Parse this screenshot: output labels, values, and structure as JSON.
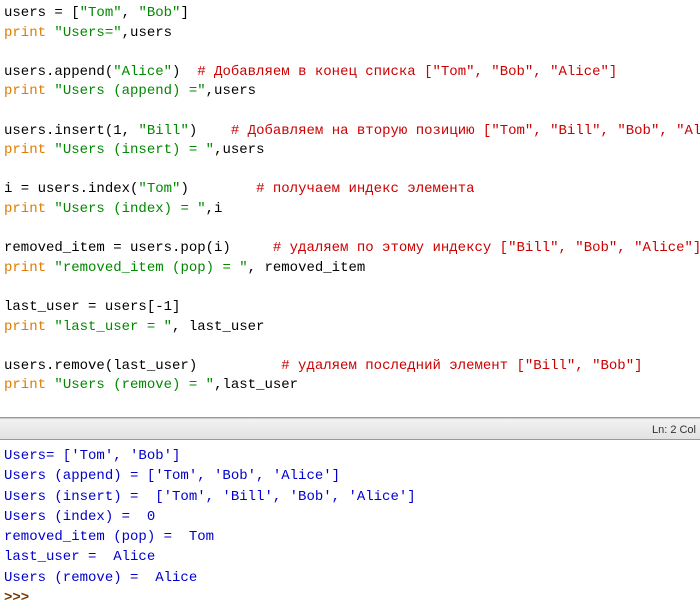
{
  "editor": {
    "l1": {
      "a": "users = [",
      "b": "\"Tom\"",
      "c": ", ",
      "d": "\"Bob\"",
      "e": "]"
    },
    "l2": {
      "kw": "print",
      "sp": " ",
      "s": "\"Users=\"",
      "tail": ",users"
    },
    "l3": {
      "a": "users.append(",
      "s": "\"Alice\"",
      "b": ")  ",
      "c": "# Добавляем в конец списка [\"Tom\", \"Bob\", \"Alice\"]"
    },
    "l4": {
      "kw": "print",
      "sp": " ",
      "s": "\"Users (append) =\"",
      "tail": ",users"
    },
    "l5": {
      "a": "users.insert(",
      "n": "1",
      "b": ", ",
      "s": "\"Bill\"",
      "c": ")    ",
      "cmt": "# Добавляем на вторую позицию [\"Tom\", \"Bill\", \"Bob\", \"Alice\"]"
    },
    "l6": {
      "kw": "print",
      "sp": " ",
      "s": "\"Users (insert) = \"",
      "tail": ",users"
    },
    "l7": {
      "a": "i = users.index(",
      "s": "\"Tom\"",
      "b": ")        ",
      "c": "# получаем индекс элемента"
    },
    "l8": {
      "kw": "print",
      "sp": " ",
      "s": "\"Users (index) = \"",
      "tail": ",i"
    },
    "l9": {
      "a": "removed_item = users.pop(i)     ",
      "c": "# удаляем по этому индексу [\"Bill\", \"Bob\", \"Alice\"]"
    },
    "l10": {
      "kw": "print",
      "sp": " ",
      "s": "\"removed_item (pop) = \"",
      "tail": ", removed_item"
    },
    "l11": {
      "a": "last_user = users[-",
      "n": "1",
      "b": "]"
    },
    "l12": {
      "kw": "print",
      "sp": " ",
      "s": "\"last_user = \"",
      "tail": ", last_user"
    },
    "l13": {
      "a": "users.remove(last_user)          ",
      "c": "# удаляем последний элемент [\"Bill\", \"Bob\"]"
    },
    "l14": {
      "kw": "print",
      "sp": " ",
      "s": "\"Users (remove) = \"",
      "tail": ",last_user"
    }
  },
  "statusbar": {
    "text": "Ln: 2   Col"
  },
  "output": {
    "o1": "Users= ['Tom', 'Bob']",
    "o2": "Users (append) = ['Tom', 'Bob', 'Alice']",
    "o3": "Users (insert) =  ['Tom', 'Bill', 'Bob', 'Alice']",
    "o4": "Users (index) =  0",
    "o5": "removed_item (pop) =  Tom",
    "o6": "last_user =  Alice",
    "o7": "Users (remove) =  Alice",
    "prompt": ">>> "
  }
}
